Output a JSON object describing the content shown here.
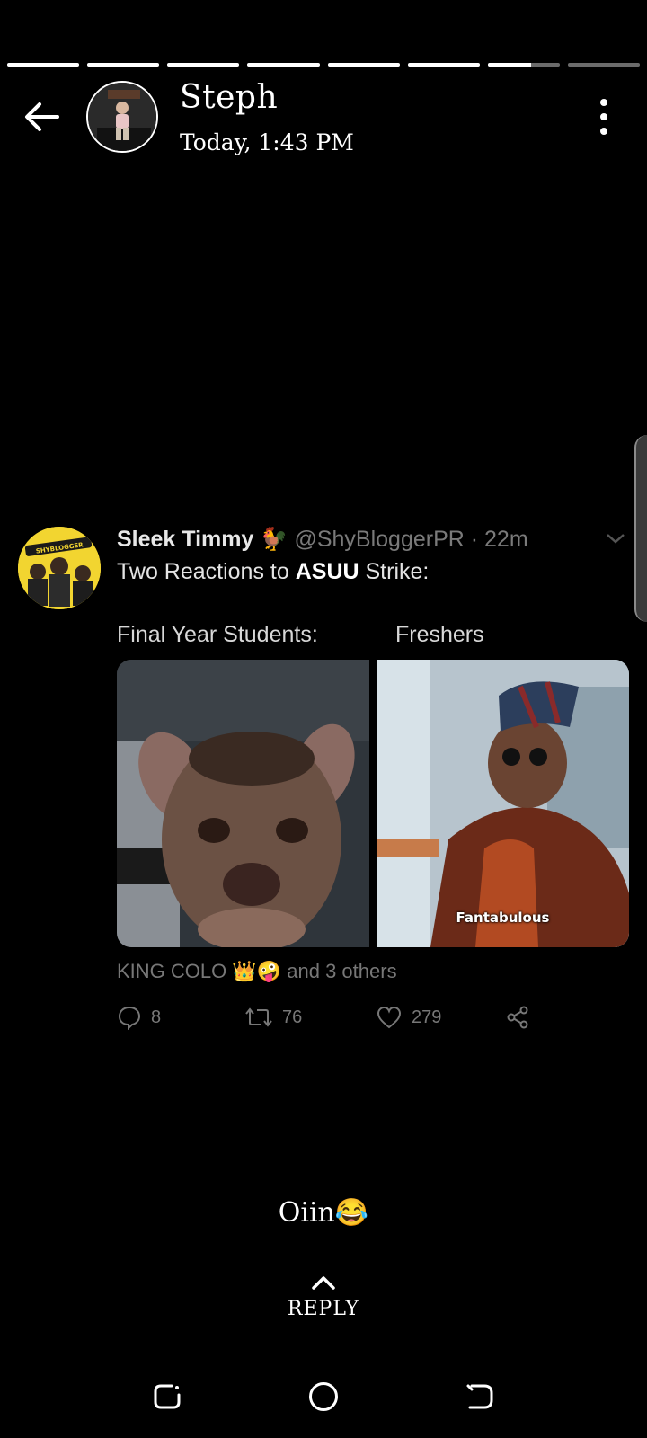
{
  "story": {
    "progress_segments": [
      1,
      1,
      1,
      1,
      1,
      1,
      0.6,
      0
    ],
    "user_name": "Steph",
    "timestamp": "Today, 1:43 PM",
    "caption": "Oiin😂",
    "reply_label": "REPLY"
  },
  "tweet": {
    "author": "Sleek Timmy",
    "author_emoji": "🐓",
    "handle_time": "@ShyBloggerPR · 22m",
    "text_prefix": "Two Reactions to ",
    "text_bold": "ASUU",
    "text_suffix": " Strike:",
    "caption_left": "Final Year Students:",
    "caption_right": "Freshers",
    "image_right_label": "Fantabulous",
    "liked_by": "KING COLO 👑🤪 and 3 others",
    "replies": "8",
    "retweets": "76",
    "likes": "279",
    "avatar_badge": "SHYBLOGGER"
  },
  "icons": {
    "back": "arrow-left-icon",
    "menu": "more-vertical-icon",
    "chevron": "chevron-down-icon",
    "reply": "comment-icon",
    "retweet": "retweet-icon",
    "like": "heart-icon",
    "share": "share-icon",
    "reply_up": "chevron-up-icon"
  },
  "colors": {
    "background": "#000000",
    "progress_fill": "#ffffff",
    "progress_track": "#6b6b6b",
    "tweet_muted": "#777777",
    "tweet_avatar_bg": "#f2d530"
  }
}
